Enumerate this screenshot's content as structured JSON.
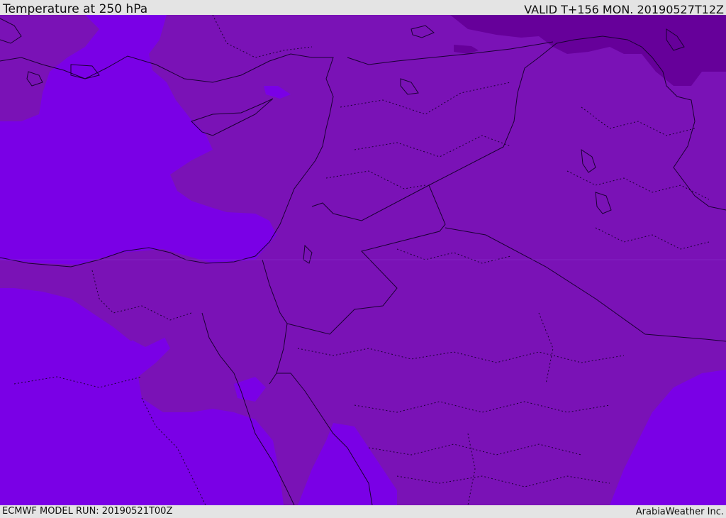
{
  "header": {
    "title": "Temperature at 250 hPa",
    "valid_time": "VALID T+156 MON. 20190527T12Z"
  },
  "footer": {
    "model_run": "ECMWF MODEL RUN: 20190521T00Z",
    "credit": "ArabiaWeather Inc."
  },
  "map": {
    "colors": {
      "coldest_band": "#66009a",
      "cold_band": "#7a12b6",
      "cool_band": "#7a00e6",
      "border_line": "#1a0033"
    }
  }
}
